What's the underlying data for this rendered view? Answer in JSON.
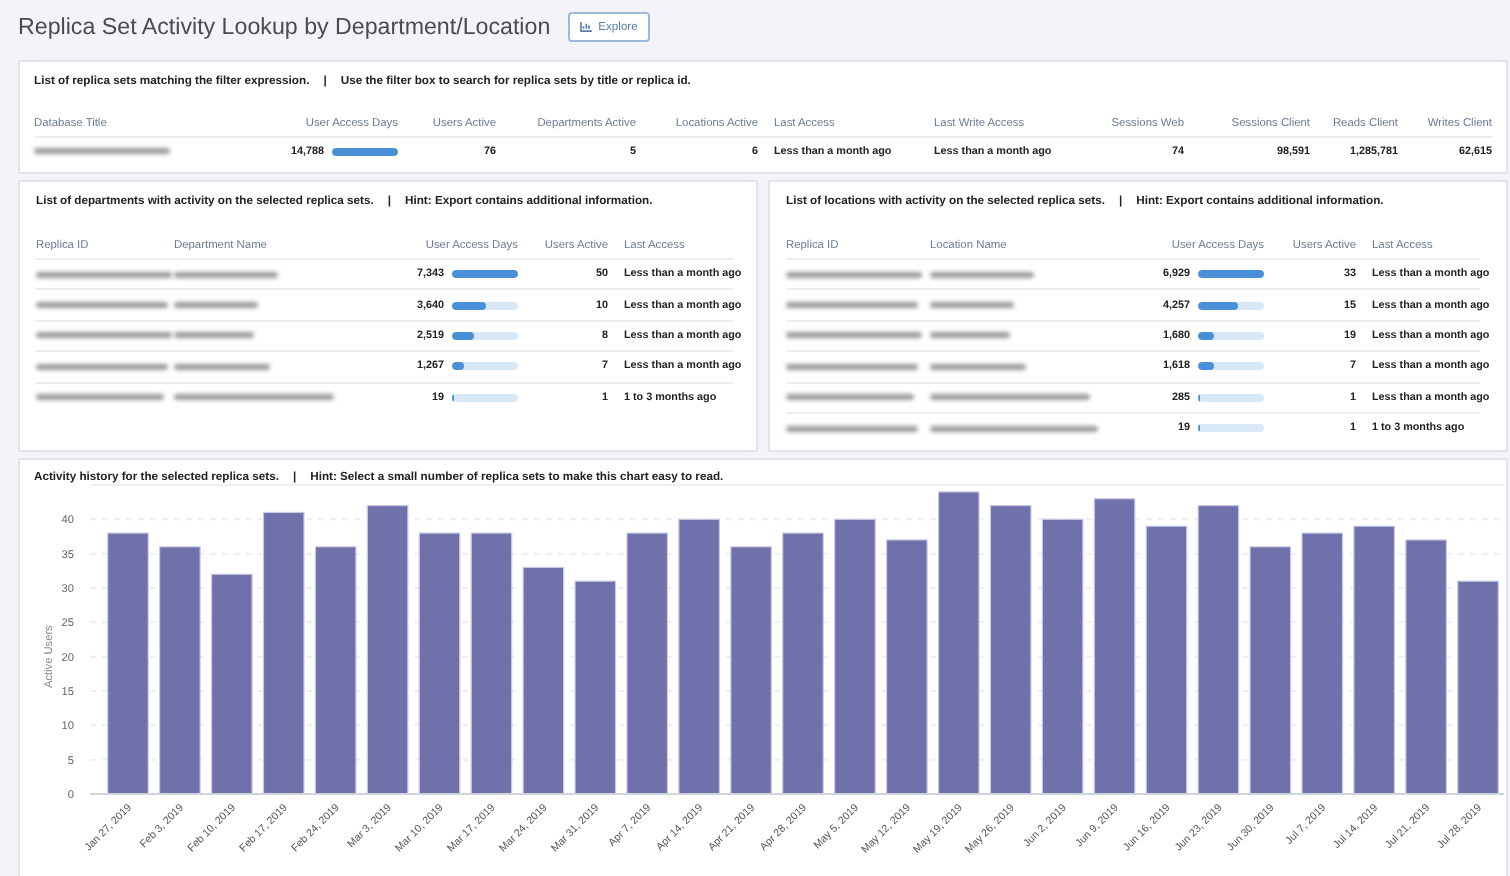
{
  "title": "Replica Set Activity Lookup by Department/Location",
  "explore_button": {
    "label": "Explore"
  },
  "replica_sets": {
    "caption": "List of replica sets matching the filter expression.",
    "separator": "|",
    "hint": "Use the filter box to search for replica sets by title or replica id.",
    "columns": [
      {
        "label": "Database Title",
        "kind": "redacted"
      },
      {
        "label": "User Access Days",
        "kind": "bar"
      },
      {
        "label": "Users Active",
        "kind": "number"
      },
      {
        "label": "Departments Active",
        "kind": "number"
      },
      {
        "label": "Locations Active",
        "kind": "number"
      },
      {
        "label": "Last Access",
        "kind": "text"
      },
      {
        "label": "Last Write Access",
        "kind": "text"
      },
      {
        "label": "Sessions Web",
        "kind": "number"
      },
      {
        "label": "Sessions Client",
        "kind": "number"
      },
      {
        "label": "Reads Client",
        "kind": "number"
      },
      {
        "label": "Writes Client",
        "kind": "number"
      }
    ],
    "rows": [
      {
        "cells": [
          null,
          "14,788",
          "76",
          "5",
          "6",
          "Less than a month ago",
          "Less than a month ago",
          "74",
          "98,591",
          "1,285,781",
          "62,615"
        ],
        "level": 1
      }
    ]
  },
  "departments": {
    "caption": "List of departments with activity on the selected replica sets.",
    "separator": "|",
    "hint": "Hint: Export contains additional information.",
    "columns": [
      {
        "label": "Replica ID",
        "kind": "redacted"
      },
      {
        "label": "Department Name",
        "kind": "redacted"
      },
      {
        "label": "User Access Days",
        "kind": "bar"
      },
      {
        "label": "Users Active",
        "kind": "number"
      },
      {
        "label": "Last Access",
        "kind": "text"
      }
    ],
    "rows": [
      {
        "cells": [
          null,
          null,
          "7,343",
          "50",
          "Less than a month ago"
        ],
        "level": 1
      },
      {
        "cells": [
          null,
          null,
          "3,640",
          "10",
          "Less than a month ago"
        ],
        "level": 0.5
      },
      {
        "cells": [
          null,
          null,
          "2,519",
          "8",
          "Less than a month ago"
        ],
        "level": 0.34
      },
      {
        "cells": [
          null,
          null,
          "1,267",
          "7",
          "Less than a month ago"
        ],
        "level": 0.17
      },
      {
        "cells": [
          null,
          null,
          "19",
          "1",
          "1 to 3 months ago"
        ],
        "level": 0.003
      }
    ]
  },
  "locations": {
    "caption": "List of locations with activity on the selected replica sets.",
    "separator": "|",
    "hint": "Hint: Export contains additional information.",
    "columns": [
      {
        "label": "Replica ID",
        "kind": "redacted"
      },
      {
        "label": "Location Name",
        "kind": "redacted"
      },
      {
        "label": "User Access Days",
        "kind": "bar"
      },
      {
        "label": "Users Active",
        "kind": "number"
      },
      {
        "label": "Last Access",
        "kind": "text"
      }
    ],
    "rows": [
      {
        "cells": [
          null,
          null,
          "6,929",
          "33",
          "Less than a month ago"
        ],
        "level": 1
      },
      {
        "cells": [
          null,
          null,
          "4,257",
          "15",
          "Less than a month ago"
        ],
        "level": 0.61
      },
      {
        "cells": [
          null,
          null,
          "1,680",
          "19",
          "Less than a month ago"
        ],
        "level": 0.24
      },
      {
        "cells": [
          null,
          null,
          "1,618",
          "7",
          "Less than a month ago"
        ],
        "level": 0.23
      },
      {
        "cells": [
          null,
          null,
          "285",
          "1",
          "Less than a month ago"
        ],
        "level": 0.04
      },
      {
        "cells": [
          null,
          null,
          "19",
          "1",
          "1 to 3 months ago"
        ],
        "level": 0.003
      }
    ]
  },
  "activity_history": {
    "caption": "Activity history for the selected replica sets.",
    "separator": "|",
    "hint": "Hint: Select a small number of replica sets to make this chart easy to read.",
    "chart_data": {
      "type": "bar",
      "ylabel": "Active Users",
      "ylim": [
        0,
        45
      ],
      "grid": true,
      "yticks": [
        0,
        5,
        10,
        15,
        20,
        25,
        30,
        35,
        40
      ],
      "categories": [
        "Jan 27, 2019",
        "Feb 3, 2019",
        "Feb 10, 2019",
        "Feb 17, 2019",
        "Feb 24, 2019",
        "Mar 3, 2019",
        "Mar 10, 2019",
        "Mar 17, 2019",
        "Mar 24, 2019",
        "Mar 31, 2019",
        "Apr 7, 2019",
        "Apr 14, 2019",
        "Apr 21, 2019",
        "Apr 28, 2019",
        "May 5, 2019",
        "May 12, 2019",
        "May 19, 2019",
        "May 26, 2019",
        "Jun 2, 2019",
        "Jun 9, 2019",
        "Jun 16, 2019",
        "Jun 23, 2019",
        "Jun 30, 2019",
        "Jul 7, 2019",
        "Jul 14, 2019",
        "Jul 21, 2019",
        "Jul 28, 2019"
      ],
      "values": [
        38,
        36,
        32,
        41,
        36,
        42,
        38,
        38,
        33,
        31,
        38,
        40,
        36,
        38,
        40,
        37,
        44,
        42,
        40,
        43,
        39,
        42,
        36,
        38,
        39,
        37,
        31
      ]
    }
  }
}
